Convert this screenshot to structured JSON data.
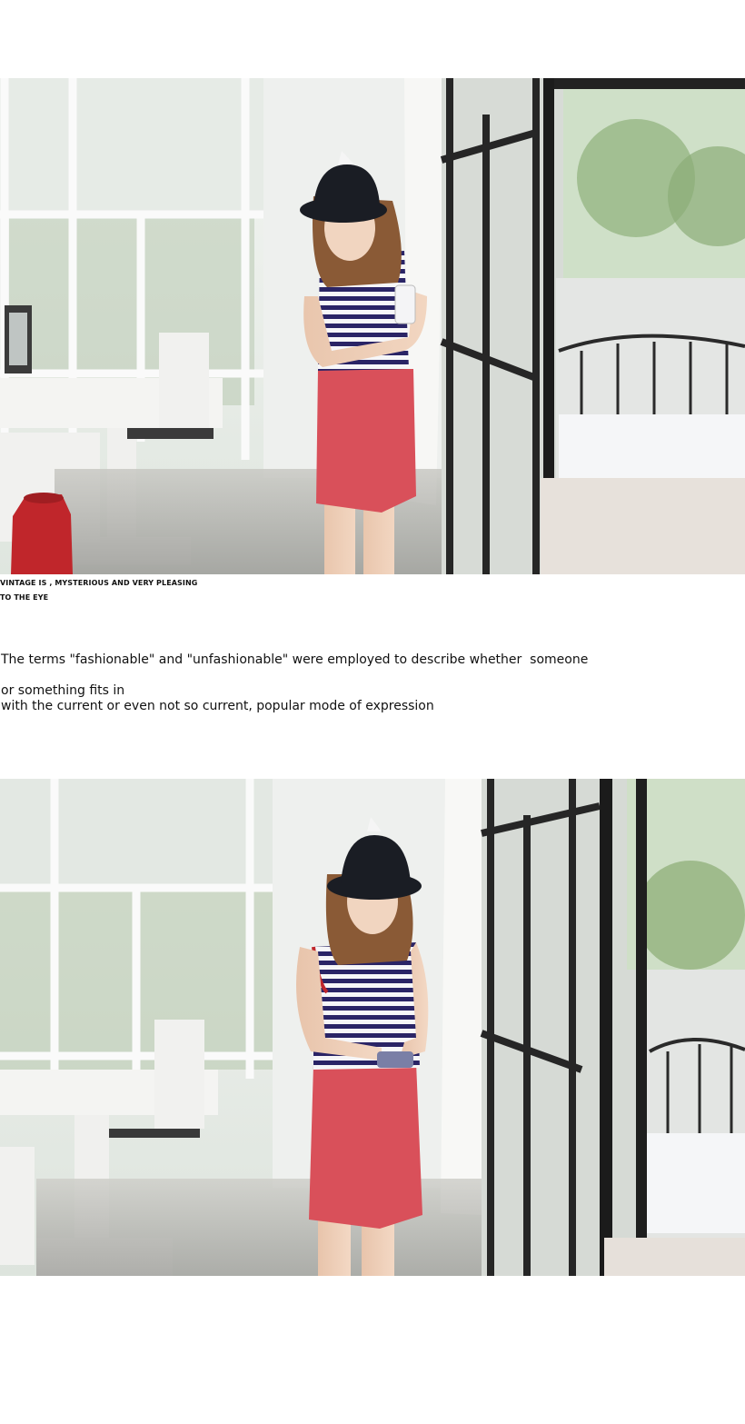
{
  "photos": [
    {
      "id": "photo-1",
      "subject": "model-standing-arms-crossed"
    },
    {
      "id": "photo-2",
      "subject": "model-holding-phone-smiling"
    }
  ],
  "caption": {
    "line1": "VINTAGE IS , MYSTERIOUS AND VERY PLEASING",
    "line2": "TO THE EYE"
  },
  "paragraph": {
    "line1": "The terms \"fashionable\" and \"unfashionable\" were employed to describe whether  someone",
    "line2": "or something fits in",
    "line3": "with the current or even not so current, popular mode of expression"
  },
  "colors": {
    "page_background": "#ffffff",
    "skirt": "#d9505a",
    "stripe_navy": "#2a2466",
    "hat": "#1a1d24",
    "window_frame": "#2b2b2b",
    "wall": "#eef0ee"
  }
}
